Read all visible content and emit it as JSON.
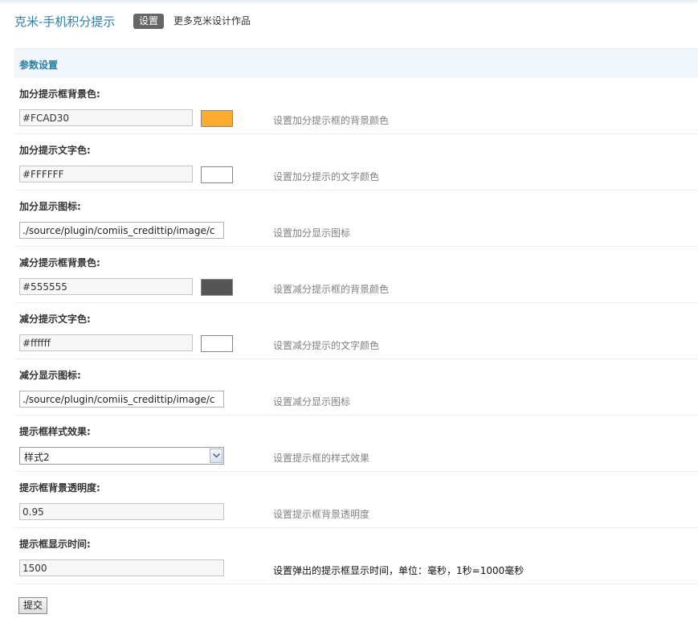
{
  "header": {
    "app_title": "克米-手机积分提示",
    "tabs": [
      {
        "label": "设置",
        "active": true
      },
      {
        "label": "更多克米设计作品",
        "active": false
      }
    ]
  },
  "section": {
    "title": "参数设置"
  },
  "fields": [
    {
      "label": "加分提示框背景色:",
      "value": "#FCAD30",
      "swatch_color": "#FCAD30",
      "description": "设置加分提示框的背景颜色"
    },
    {
      "label": "加分提示文字色:",
      "value": "#FFFFFF",
      "swatch_color": "#FFFFFF",
      "description": "设置加分提示的文字颜色"
    },
    {
      "label": "加分显示图标:",
      "value": "./source/plugin/comiis_credittip/image/c",
      "description": "设置加分显示图标"
    },
    {
      "label": "减分提示框背景色:",
      "value": "#555555",
      "swatch_color": "#555555",
      "description": "设置减分提示框的背景颜色"
    },
    {
      "label": "减分提示文字色:",
      "value": "#ffffff",
      "swatch_color": "#ffffff",
      "description": "设置减分提示的文字颜色"
    },
    {
      "label": "减分显示图标:",
      "value": "./source/plugin/comiis_credittip/image/c",
      "description": "设置减分显示图标"
    },
    {
      "label": "提示框样式效果:",
      "value": "样式2",
      "description": "设置提示框的样式效果"
    },
    {
      "label": "提示框背景透明度:",
      "value": "0.95",
      "description": "设置提示框背景透明度"
    },
    {
      "label": "提示框显示时间:",
      "value": "1500",
      "description": "设置弹出的提示框显示时间，单位：毫秒，1秒=1000毫秒"
    }
  ],
  "submit_label": "提交",
  "colors": {
    "accent": "#2B7FA6",
    "section_bg": "#F1F6FB",
    "description_text": "#808080"
  },
  "icons": {
    "select_arrow": "chevron-down-icon"
  }
}
